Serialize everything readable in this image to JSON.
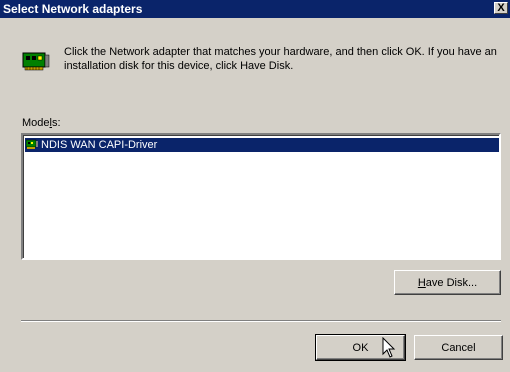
{
  "window": {
    "title": "Select Network adapters",
    "close_label": "X"
  },
  "instructions": "Click the Network adapter that matches your hardware, and then click OK. If you have an installation disk for this device, click Have Disk.",
  "models": {
    "label_pre": "Mode",
    "label_accel": "l",
    "label_post": "s:",
    "items": [
      "NDIS WAN CAPI-Driver"
    ],
    "selected_index": 0
  },
  "buttons": {
    "have_disk_accel": "H",
    "have_disk_rest": "ave Disk...",
    "ok": "OK",
    "cancel": "Cancel"
  },
  "colors": {
    "title_bar": "#0a246a",
    "face": "#d4d0c8",
    "selection": "#0a246a"
  },
  "icons": {
    "header": "network-adapter-icon",
    "item": "network-card-icon",
    "cursor": "mouse-pointer-icon"
  }
}
